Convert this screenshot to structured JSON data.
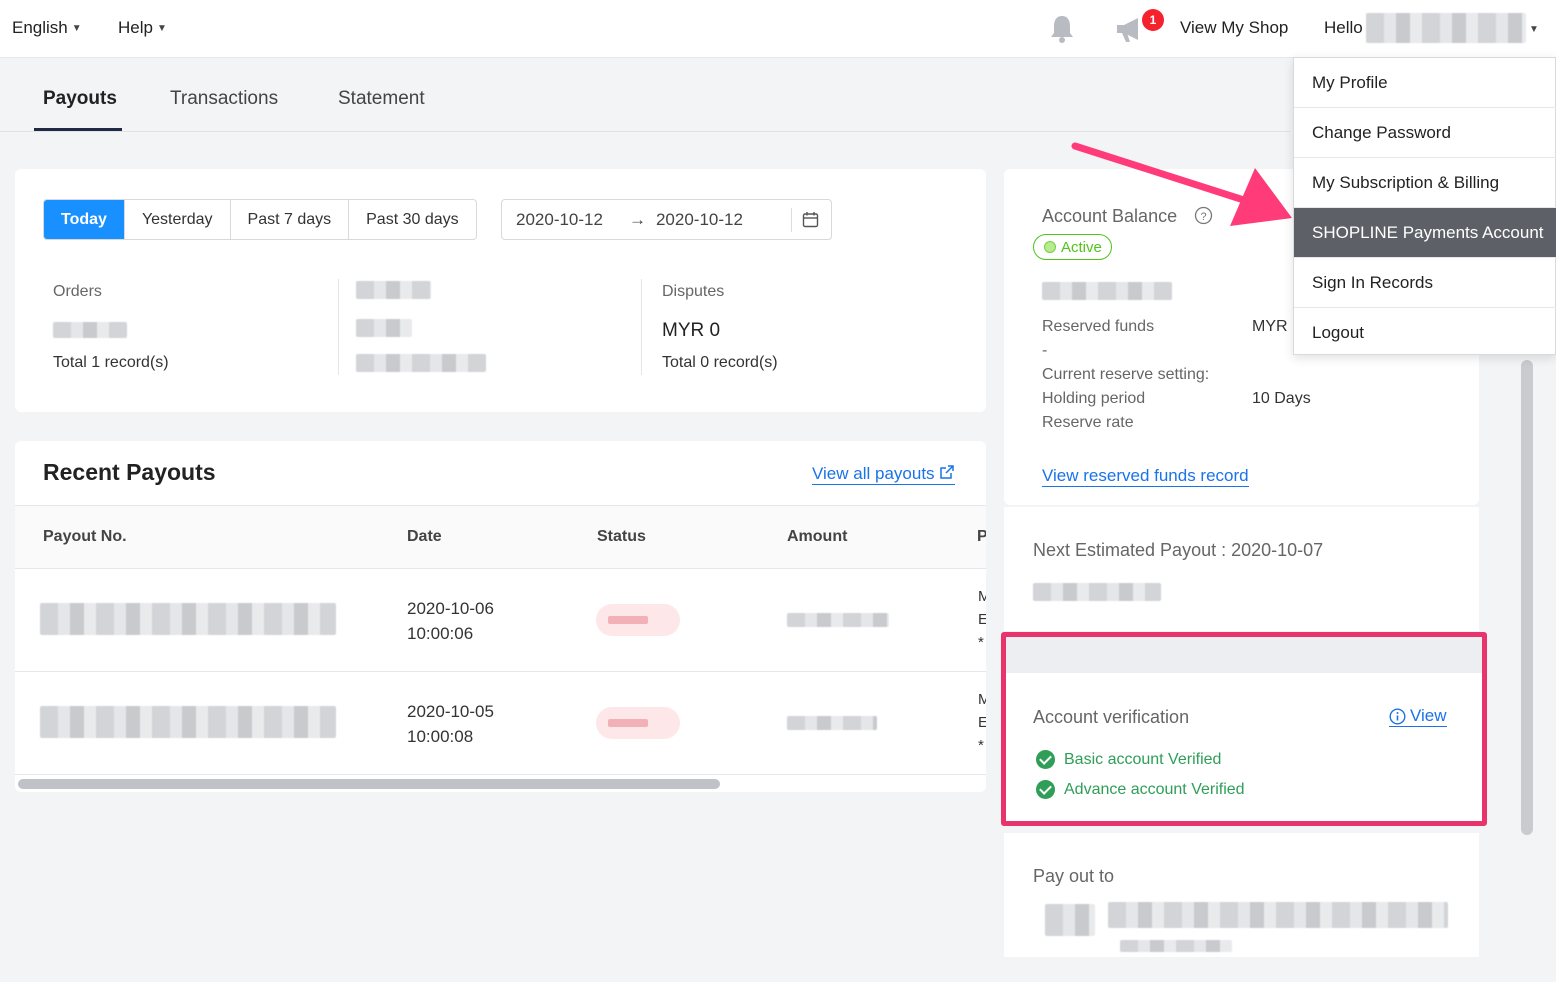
{
  "topbar": {
    "language": "English",
    "help": "Help",
    "notification_count": "1",
    "view_shop": "View My Shop",
    "hello": "Hello"
  },
  "tabs": [
    {
      "label": "Payouts",
      "active": true
    },
    {
      "label": "Transactions",
      "active": false
    },
    {
      "label": "Statement",
      "active": false
    }
  ],
  "summary": {
    "ranges": [
      "Today",
      "Yesterday",
      "Past 7 days",
      "Past 30 days"
    ],
    "selected_range": "Today",
    "date_from": "2020-10-12",
    "date_arrow": "→",
    "date_to": "2020-10-12",
    "orders_label": "Orders",
    "orders_total": "Total 1 record(s)",
    "disputes_label": "Disputes",
    "disputes_value": "MYR 0",
    "disputes_total": "Total 0 record(s)"
  },
  "recent_payouts": {
    "title": "Recent Payouts",
    "view_all": "View all payouts",
    "columns": [
      "Payout No.",
      "Date",
      "Status",
      "Amount",
      "P"
    ],
    "rows": [
      {
        "date": "2020-10-06",
        "time": "10:00:06",
        "trail": [
          "M",
          "E",
          "*"
        ]
      },
      {
        "date": "2020-10-05",
        "time": "10:00:08",
        "trail": [
          "M",
          "E",
          "*"
        ]
      }
    ]
  },
  "account": {
    "balance_label": "Account Balance",
    "status": "Active",
    "reserved_funds_label": "Reserved funds",
    "reserved_funds_currency": "MYR",
    "dash": "-",
    "current_reserve_label": "Current reserve setting:",
    "holding_period_label": "Holding period",
    "holding_period_value": "10 Days",
    "reserve_rate_label": "Reserve rate",
    "view_reserved": "View reserved funds record",
    "next_payout_label": "Next Estimated Payout : 2020-10-07",
    "verification_label": "Account verification",
    "verification_view": "View",
    "basic_verified": "Basic account Verified",
    "advance_verified": "Advance account Verified",
    "pay_out_to": "Pay out to"
  },
  "user_menu": {
    "items": [
      "My Profile",
      "Change Password",
      "My Subscription & Billing",
      "SHOPLINE Payments Account",
      "Sign In Records",
      "Logout"
    ],
    "highlighted": "SHOPLINE Payments Account"
  },
  "colors": {
    "primary": "#1890ff",
    "link": "#1a73e8",
    "success": "#2e9e58",
    "annotation": "#ff3b7a",
    "menu_highlight": "#5d6066"
  }
}
